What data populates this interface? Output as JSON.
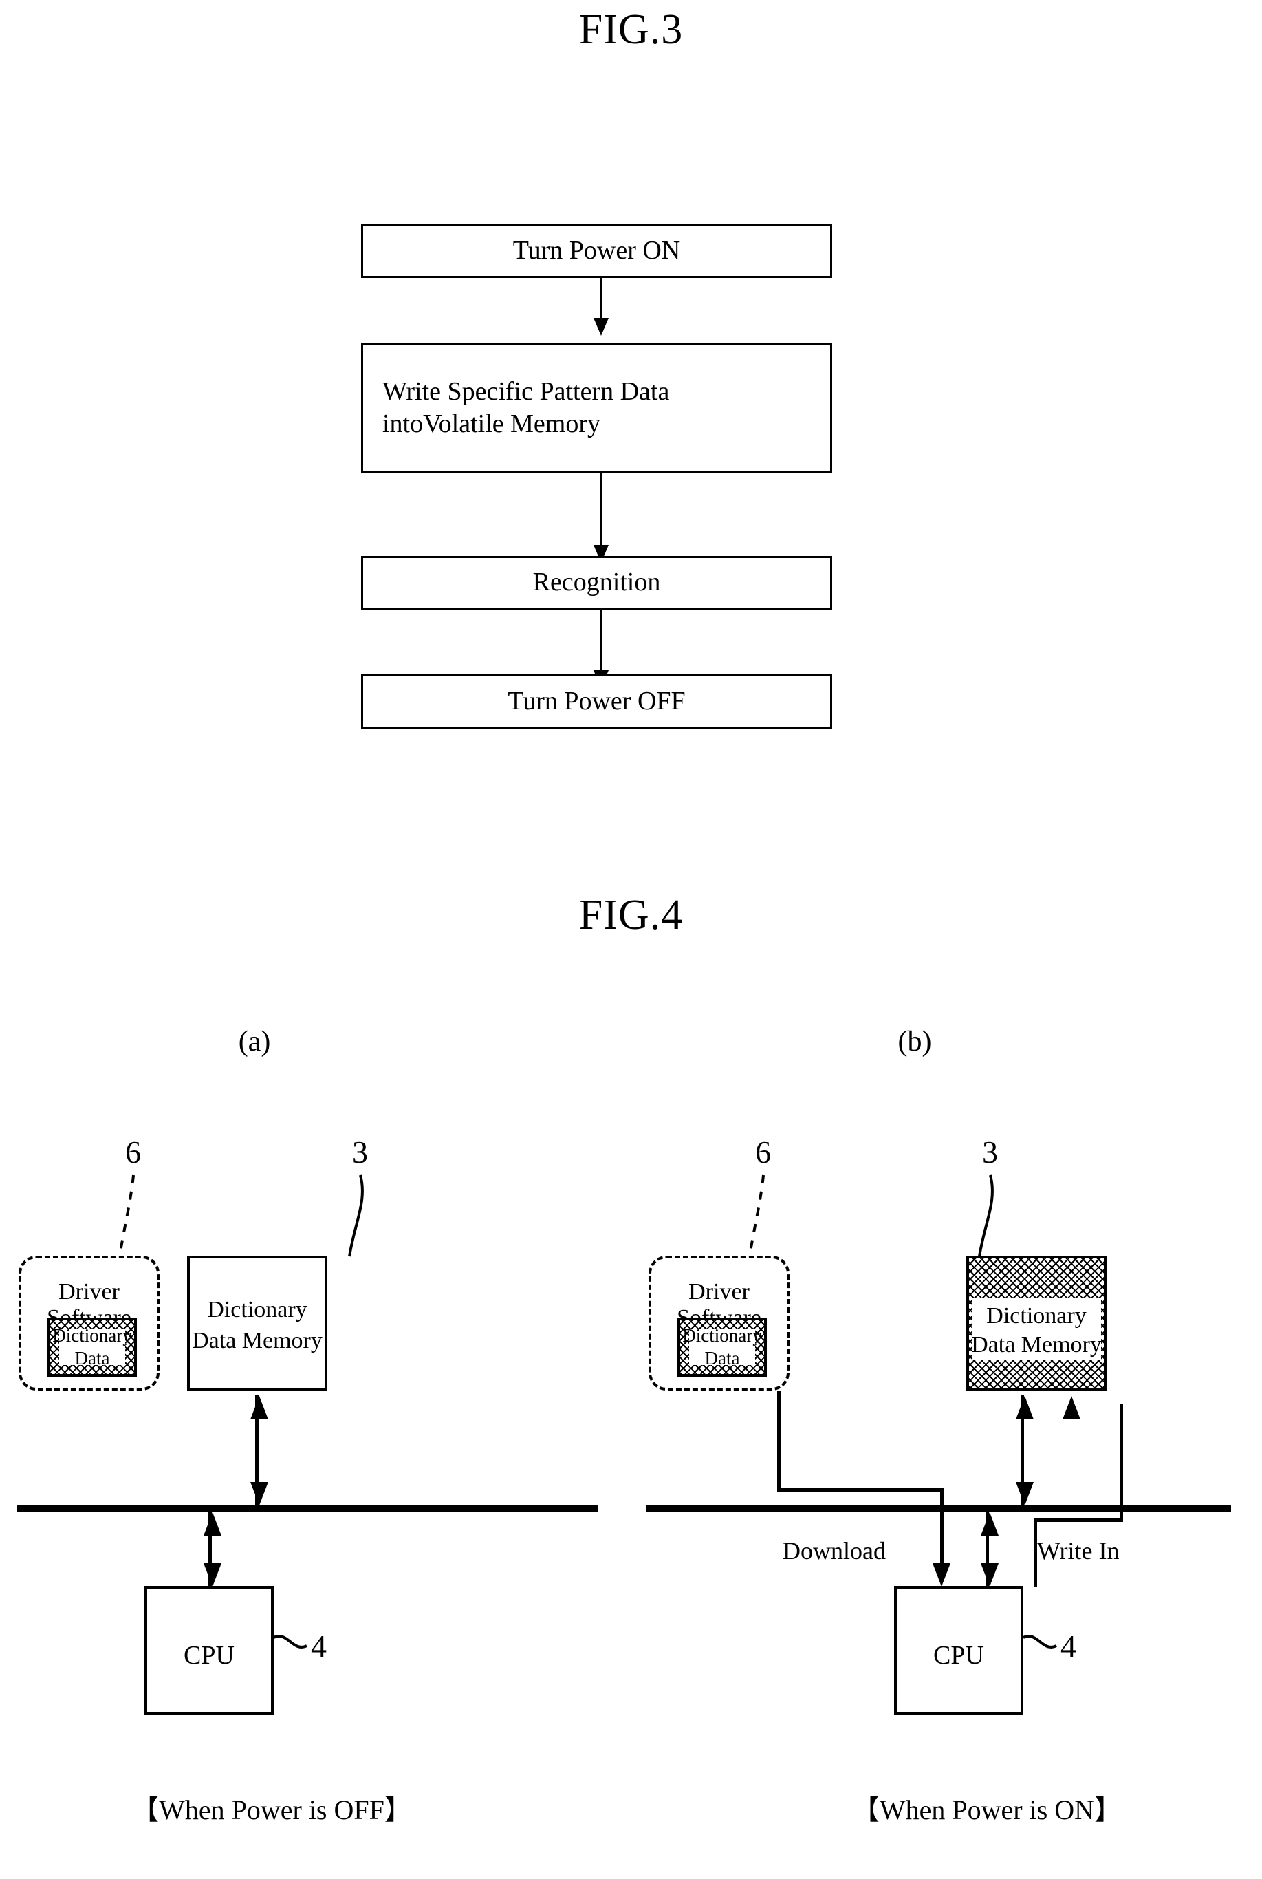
{
  "figures": {
    "fig3": {
      "title": "FIG.3",
      "steps": [
        {
          "label": "Turn Power ON"
        },
        {
          "label_line1": "Write Specific Pattern Data",
          "label_line2": "intoVolatile Memory"
        },
        {
          "label": "Recognition"
        },
        {
          "label": "Turn Power OFF"
        }
      ]
    },
    "fig4": {
      "title": "FIG.4",
      "panels": [
        {
          "key": "a",
          "panel_label": "(a)",
          "caption": "【When Power is OFF】",
          "driver_software": {
            "ref": "6",
            "title": "Driver Software",
            "chip_line1": "Dictionary",
            "chip_line2": "Data",
            "chip_filled": "true"
          },
          "memory": {
            "ref": "3",
            "line1": "Dictionary",
            "line2": "Data Memory",
            "filled": "false"
          },
          "cpu": {
            "ref": "4",
            "label": "CPU"
          },
          "flow_labels": []
        },
        {
          "key": "b",
          "panel_label": "(b)",
          "caption": "【When Power is ON】",
          "driver_software": {
            "ref": "6",
            "title": "Driver Software",
            "chip_line1": "Dictionary",
            "chip_line2": "Data",
            "chip_filled": "true"
          },
          "memory": {
            "ref": "3",
            "line1": "Dictionary",
            "line2": "Data Memory",
            "filled": "true"
          },
          "cpu": {
            "ref": "4",
            "label": "CPU"
          },
          "flow_labels": [
            {
              "label": "Download"
            },
            {
              "label": "Write In"
            }
          ]
        }
      ]
    }
  },
  "colors": {
    "ink": "#000000",
    "paper": "#ffffff"
  }
}
